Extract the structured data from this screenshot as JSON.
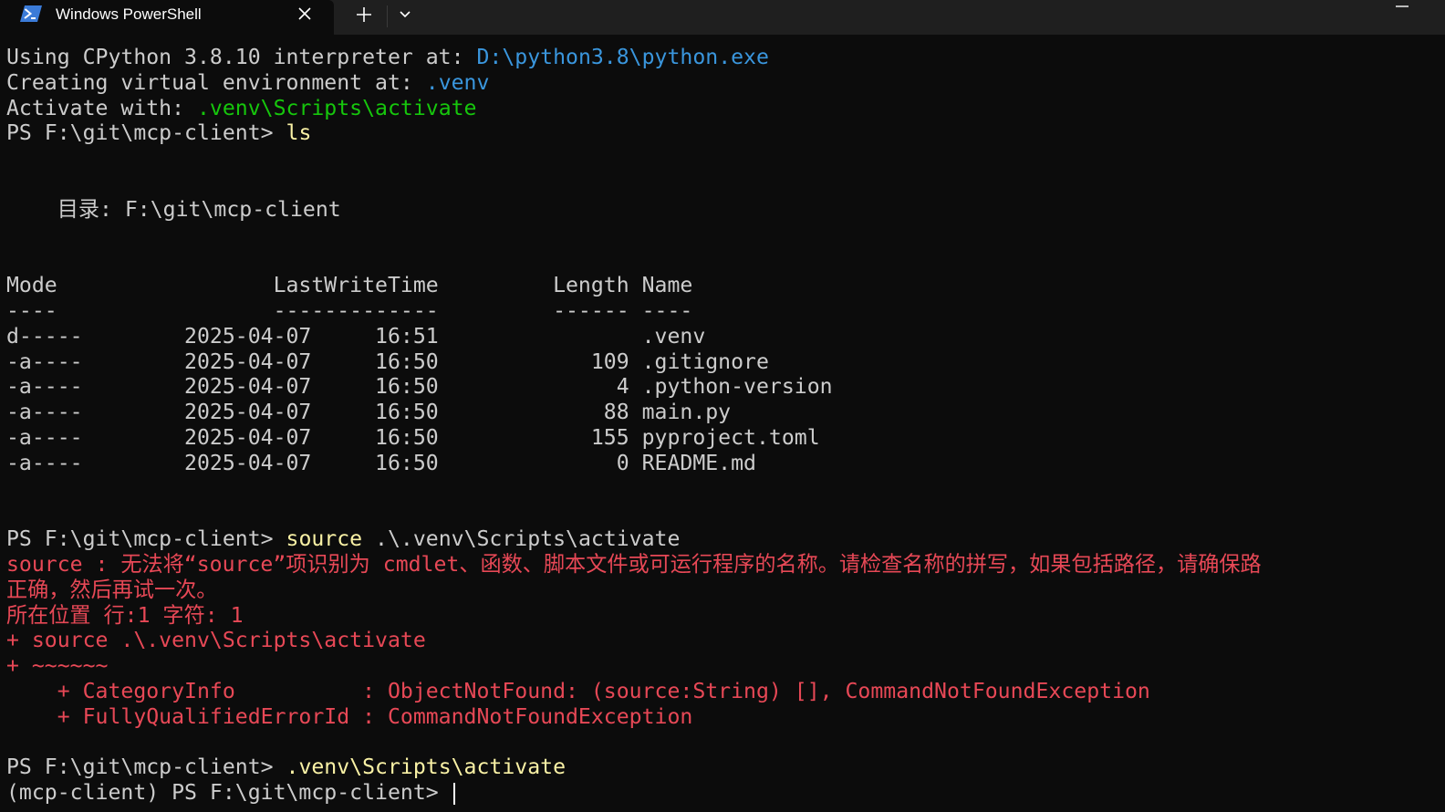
{
  "window": {
    "tab_title": "Windows PowerShell"
  },
  "terminal": {
    "l1_text": "Using CPython 3.8.10 interpreter at: ",
    "l1_path": "D:\\python3.8\\python.exe",
    "l2_text": "Creating virtual environment at: ",
    "l2_path": ".venv",
    "l3_text": "Activate with: ",
    "l3_cmd": ".venv\\Scripts\\activate",
    "prompt": "PS F:\\git\\mcp-client> ",
    "cmd_ls": "ls",
    "dir_label": "    目录: F:\\git\\mcp-client",
    "header": "Mode                 LastWriteTime         Length Name",
    "header_underline": "----                 -------------         ------ ----",
    "rows": [
      "d-----        2025-04-07     16:51                .venv",
      "-a----        2025-04-07     16:50            109 .gitignore",
      "-a----        2025-04-07     16:50              4 .python-version",
      "-a----        2025-04-07     16:50             88 main.py",
      "-a----        2025-04-07     16:50            155 pyproject.toml",
      "-a----        2025-04-07     16:50              0 README.md"
    ],
    "cmd_source_keyword": "source",
    "cmd_source_args": " .\\.venv\\Scripts\\activate",
    "error_lines": [
      "source : 无法将“source”项识别为 cmdlet、函数、脚本文件或可运行程序的名称。请检查名称的拼写，如果包括路径，请确保路",
      "正确，然后再试一次。",
      "所在位置 行:1 字符: 1",
      "+ source .\\.venv\\Scripts\\activate",
      "+ ~~~~~~",
      "    + CategoryInfo          : ObjectNotFound: (source:String) [], CommandNotFoundException",
      "    + FullyQualifiedErrorId : CommandNotFoundException"
    ],
    "cmd_activate": ".venv\\Scripts\\activate",
    "final_prompt": "(mcp-client) PS F:\\git\\mcp-client> "
  },
  "colors": {
    "background": "#0c0c0c",
    "text": "#cccccc",
    "path": "#3a96dd",
    "activate": "#16c60c",
    "command": "#f9f1a5",
    "error": "#e74856"
  },
  "icons": {
    "tab": "powershell-icon",
    "close": "close-icon",
    "new_tab": "plus-icon",
    "dropdown": "chevron-down-icon",
    "minimize": "minimize-icon"
  }
}
